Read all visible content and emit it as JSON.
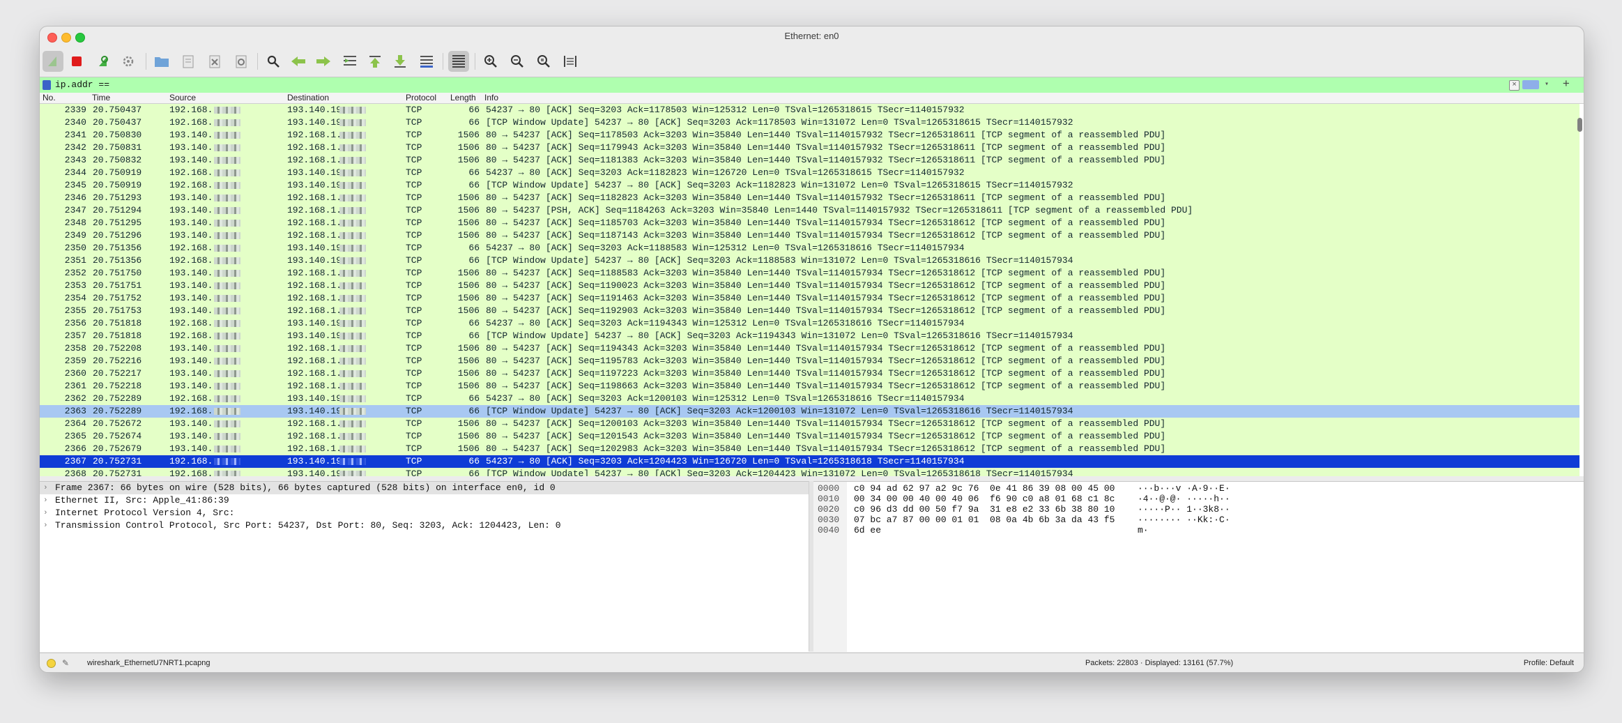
{
  "window": {
    "title": "Ethernet: en0"
  },
  "toolbar": {
    "buttons": [
      {
        "icon": "shark-fin-start-icon"
      },
      {
        "icon": "stop-capture-icon"
      },
      {
        "icon": "restart-capture-icon"
      },
      {
        "icon": "capture-options-gear-icon"
      },
      {
        "icon": "open-folder-icon"
      },
      {
        "icon": "save-file-icon"
      },
      {
        "icon": "close-file-icon"
      },
      {
        "icon": "reload-file-icon"
      },
      {
        "icon": "find-packet-icon"
      },
      {
        "icon": "go-back-icon"
      },
      {
        "icon": "go-forward-icon"
      },
      {
        "icon": "go-to-packet-icon"
      },
      {
        "icon": "go-first-icon"
      },
      {
        "icon": "go-last-icon"
      },
      {
        "icon": "auto-scroll-icon"
      },
      {
        "icon": "colorize-icon"
      },
      {
        "icon": "zoom-in-icon"
      },
      {
        "icon": "zoom-out-icon"
      },
      {
        "icon": "normal-size-icon"
      },
      {
        "icon": "resize-columns-icon"
      }
    ]
  },
  "filter": {
    "value": "ip.addr ==",
    "background": "#afffaf"
  },
  "columns": {
    "no": "No.",
    "time": "Time",
    "source": "Source",
    "destination": "Destination",
    "protocol": "Protocol",
    "length": "Length",
    "info": "Info"
  },
  "packets": [
    {
      "no": "2339",
      "time": "20.750437",
      "src": "192.168.",
      "dst": "193.140.19",
      "proto": "TCP",
      "len": "66",
      "info": "54237 → 80 [ACK] Seq=3203 Ack=1178503 Win=125312 Len=0 TSval=1265318615 TSecr=1140157932"
    },
    {
      "no": "2340",
      "time": "20.750437",
      "src": "192.168.",
      "dst": "193.140.19",
      "proto": "TCP",
      "len": "66",
      "info": "[TCP Window Update] 54237 → 80 [ACK] Seq=3203 Ack=1178503 Win=131072 Len=0 TSval=1265318615 TSecr=1140157932"
    },
    {
      "no": "2341",
      "time": "20.750830",
      "src": "193.140.",
      "dst": "192.168.1.",
      "proto": "TCP",
      "len": "1506",
      "info": "80 → 54237 [ACK] Seq=1178503 Ack=3203 Win=35840 Len=1440 TSval=1140157932 TSecr=1265318611 [TCP segment of a reassembled PDU]"
    },
    {
      "no": "2342",
      "time": "20.750831",
      "src": "193.140.",
      "dst": "192.168.1.",
      "proto": "TCP",
      "len": "1506",
      "info": "80 → 54237 [ACK] Seq=1179943 Ack=3203 Win=35840 Len=1440 TSval=1140157932 TSecr=1265318611 [TCP segment of a reassembled PDU]"
    },
    {
      "no": "2343",
      "time": "20.750832",
      "src": "193.140.",
      "dst": "192.168.1.",
      "proto": "TCP",
      "len": "1506",
      "info": "80 → 54237 [ACK] Seq=1181383 Ack=3203 Win=35840 Len=1440 TSval=1140157932 TSecr=1265318611 [TCP segment of a reassembled PDU]"
    },
    {
      "no": "2344",
      "time": "20.750919",
      "src": "192.168.",
      "dst": "193.140.19",
      "proto": "TCP",
      "len": "66",
      "info": "54237 → 80 [ACK] Seq=3203 Ack=1182823 Win=126720 Len=0 TSval=1265318615 TSecr=1140157932"
    },
    {
      "no": "2345",
      "time": "20.750919",
      "src": "192.168.",
      "dst": "193.140.19",
      "proto": "TCP",
      "len": "66",
      "info": "[TCP Window Update] 54237 → 80 [ACK] Seq=3203 Ack=1182823 Win=131072 Len=0 TSval=1265318615 TSecr=1140157932"
    },
    {
      "no": "2346",
      "time": "20.751293",
      "src": "193.140.",
      "dst": "192.168.1.",
      "proto": "TCP",
      "len": "1506",
      "info": "80 → 54237 [ACK] Seq=1182823 Ack=3203 Win=35840 Len=1440 TSval=1140157932 TSecr=1265318611 [TCP segment of a reassembled PDU]"
    },
    {
      "no": "2347",
      "time": "20.751294",
      "src": "193.140.",
      "dst": "192.168.1.",
      "proto": "TCP",
      "len": "1506",
      "info": "80 → 54237 [PSH, ACK] Seq=1184263 Ack=3203 Win=35840 Len=1440 TSval=1140157932 TSecr=1265318611 [TCP segment of a reassembled PDU]"
    },
    {
      "no": "2348",
      "time": "20.751295",
      "src": "193.140.",
      "dst": "192.168.1.",
      "proto": "TCP",
      "len": "1506",
      "info": "80 → 54237 [ACK] Seq=1185703 Ack=3203 Win=35840 Len=1440 TSval=1140157934 TSecr=1265318612 [TCP segment of a reassembled PDU]"
    },
    {
      "no": "2349",
      "time": "20.751296",
      "src": "193.140.",
      "dst": "192.168.1.",
      "proto": "TCP",
      "len": "1506",
      "info": "80 → 54237 [ACK] Seq=1187143 Ack=3203 Win=35840 Len=1440 TSval=1140157934 TSecr=1265318612 [TCP segment of a reassembled PDU]"
    },
    {
      "no": "2350",
      "time": "20.751356",
      "src": "192.168.",
      "dst": "193.140.19",
      "proto": "TCP",
      "len": "66",
      "info": "54237 → 80 [ACK] Seq=3203 Ack=1188583 Win=125312 Len=0 TSval=1265318616 TSecr=1140157934"
    },
    {
      "no": "2351",
      "time": "20.751356",
      "src": "192.168.",
      "dst": "193.140.19",
      "proto": "TCP",
      "len": "66",
      "info": "[TCP Window Update] 54237 → 80 [ACK] Seq=3203 Ack=1188583 Win=131072 Len=0 TSval=1265318616 TSecr=1140157934"
    },
    {
      "no": "2352",
      "time": "20.751750",
      "src": "193.140.",
      "dst": "192.168.1.",
      "proto": "TCP",
      "len": "1506",
      "info": "80 → 54237 [ACK] Seq=1188583 Ack=3203 Win=35840 Len=1440 TSval=1140157934 TSecr=1265318612 [TCP segment of a reassembled PDU]"
    },
    {
      "no": "2353",
      "time": "20.751751",
      "src": "193.140.",
      "dst": "192.168.1.",
      "proto": "TCP",
      "len": "1506",
      "info": "80 → 54237 [ACK] Seq=1190023 Ack=3203 Win=35840 Len=1440 TSval=1140157934 TSecr=1265318612 [TCP segment of a reassembled PDU]"
    },
    {
      "no": "2354",
      "time": "20.751752",
      "src": "193.140.",
      "dst": "192.168.1.",
      "proto": "TCP",
      "len": "1506",
      "info": "80 → 54237 [ACK] Seq=1191463 Ack=3203 Win=35840 Len=1440 TSval=1140157934 TSecr=1265318612 [TCP segment of a reassembled PDU]"
    },
    {
      "no": "2355",
      "time": "20.751753",
      "src": "193.140.",
      "dst": "192.168.1.",
      "proto": "TCP",
      "len": "1506",
      "info": "80 → 54237 [ACK] Seq=1192903 Ack=3203 Win=35840 Len=1440 TSval=1140157934 TSecr=1265318612 [TCP segment of a reassembled PDU]"
    },
    {
      "no": "2356",
      "time": "20.751818",
      "src": "192.168.",
      "dst": "193.140.19",
      "proto": "TCP",
      "len": "66",
      "info": "54237 → 80 [ACK] Seq=3203 Ack=1194343 Win=125312 Len=0 TSval=1265318616 TSecr=1140157934"
    },
    {
      "no": "2357",
      "time": "20.751818",
      "src": "192.168.",
      "dst": "193.140.19",
      "proto": "TCP",
      "len": "66",
      "info": "[TCP Window Update] 54237 → 80 [ACK] Seq=3203 Ack=1194343 Win=131072 Len=0 TSval=1265318616 TSecr=1140157934"
    },
    {
      "no": "2358",
      "time": "20.752208",
      "src": "193.140.",
      "dst": "192.168.1.",
      "proto": "TCP",
      "len": "1506",
      "info": "80 → 54237 [ACK] Seq=1194343 Ack=3203 Win=35840 Len=1440 TSval=1140157934 TSecr=1265318612 [TCP segment of a reassembled PDU]"
    },
    {
      "no": "2359",
      "time": "20.752216",
      "src": "193.140.",
      "dst": "192.168.1.",
      "proto": "TCP",
      "len": "1506",
      "info": "80 → 54237 [ACK] Seq=1195783 Ack=3203 Win=35840 Len=1440 TSval=1140157934 TSecr=1265318612 [TCP segment of a reassembled PDU]"
    },
    {
      "no": "2360",
      "time": "20.752217",
      "src": "193.140.",
      "dst": "192.168.1.",
      "proto": "TCP",
      "len": "1506",
      "info": "80 → 54237 [ACK] Seq=1197223 Ack=3203 Win=35840 Len=1440 TSval=1140157934 TSecr=1265318612 [TCP segment of a reassembled PDU]"
    },
    {
      "no": "2361",
      "time": "20.752218",
      "src": "193.140.",
      "dst": "192.168.1.",
      "proto": "TCP",
      "len": "1506",
      "info": "80 → 54237 [ACK] Seq=1198663 Ack=3203 Win=35840 Len=1440 TSval=1140157934 TSecr=1265318612 [TCP segment of a reassembled PDU]"
    },
    {
      "no": "2362",
      "time": "20.752289",
      "src": "192.168.",
      "dst": "193.140.19",
      "proto": "TCP",
      "len": "66",
      "info": "54237 → 80 [ACK] Seq=3203 Ack=1200103 Win=125312 Len=0 TSval=1265318616 TSecr=1140157934"
    },
    {
      "no": "2363",
      "time": "20.752289",
      "src": "192.168.",
      "dst": "193.140.19",
      "proto": "TCP",
      "len": "66",
      "info": "[TCP Window Update] 54237 → 80 [ACK] Seq=3203 Ack=1200103 Win=131072 Len=0 TSval=1265318616 TSecr=1140157934",
      "state": "sel-light"
    },
    {
      "no": "2364",
      "time": "20.752672",
      "src": "193.140.",
      "dst": "192.168.1.",
      "proto": "TCP",
      "len": "1506",
      "info": "80 → 54237 [ACK] Seq=1200103 Ack=3203 Win=35840 Len=1440 TSval=1140157934 TSecr=1265318612 [TCP segment of a reassembled PDU]"
    },
    {
      "no": "2365",
      "time": "20.752674",
      "src": "193.140.",
      "dst": "192.168.1.",
      "proto": "TCP",
      "len": "1506",
      "info": "80 → 54237 [ACK] Seq=1201543 Ack=3203 Win=35840 Len=1440 TSval=1140157934 TSecr=1265318612 [TCP segment of a reassembled PDU]"
    },
    {
      "no": "2366",
      "time": "20.752679",
      "src": "193.140.",
      "dst": "192.168.1.",
      "proto": "TCP",
      "len": "1506",
      "info": "80 → 54237 [ACK] Seq=1202983 Ack=3203 Win=35840 Len=1440 TSval=1140157934 TSecr=1265318612 [TCP segment of a reassembled PDU]"
    },
    {
      "no": "2367",
      "time": "20.752731",
      "src": "192.168.",
      "dst": "193.140.19",
      "proto": "TCP",
      "len": "66",
      "info": "54237 → 80 [ACK] Seq=3203 Ack=1204423 Win=126720 Len=0 TSval=1265318618 TSecr=1140157934",
      "state": "sel-dark"
    },
    {
      "no": "2368",
      "time": "20.752731",
      "src": "192.168.",
      "dst": "193.140.19",
      "proto": "TCP",
      "len": "66",
      "info": "[TCP Window Update] 54237 → 80 [ACK] Seq=3203 Ack=1204423 Win=131072 Len=0 TSval=1265318618 TSecr=1140157934"
    }
  ],
  "details": [
    "Frame 2367: 66 bytes on wire (528 bits), 66 bytes captured (528 bits) on interface en0, id 0",
    "Ethernet II, Src: Apple_41:86:39",
    "Internet Protocol Version 4, Src:",
    "Transmission Control Protocol, Src Port: 54237, Dst Port: 80, Seq: 3203, Ack: 1204423, Len: 0"
  ],
  "hex": [
    {
      "offset": "0000",
      "bytes": "c0 94 ad 62 97 a2 9c 76  0e 41 86 39 08 00 45 00",
      "ascii": "···b···v ·A·9··E·"
    },
    {
      "offset": "0010",
      "bytes": "00 34 00 00 40 00 40 06  f6 90 c0 a8 01 68 c1 8c",
      "ascii": "·4··@·@· ·····h··"
    },
    {
      "offset": "0020",
      "bytes": "c0 96 d3 dd 00 50 f7 9a  31 e8 e2 33 6b 38 80 10",
      "ascii": "·····P·· 1··3k8··"
    },
    {
      "offset": "0030",
      "bytes": "07 bc a7 87 00 00 01 01  08 0a 4b 6b 3a da 43 f5",
      "ascii": "········ ··Kk:·C·"
    },
    {
      "offset": "0040",
      "bytes": "6d ee",
      "ascii": "m·"
    }
  ],
  "status": {
    "file": "wireshark_EthernetU7NRT1.pcapng",
    "packets": "Packets: 22803 · Displayed: 13161 (57.7%)",
    "profile": "Profile: Default"
  }
}
